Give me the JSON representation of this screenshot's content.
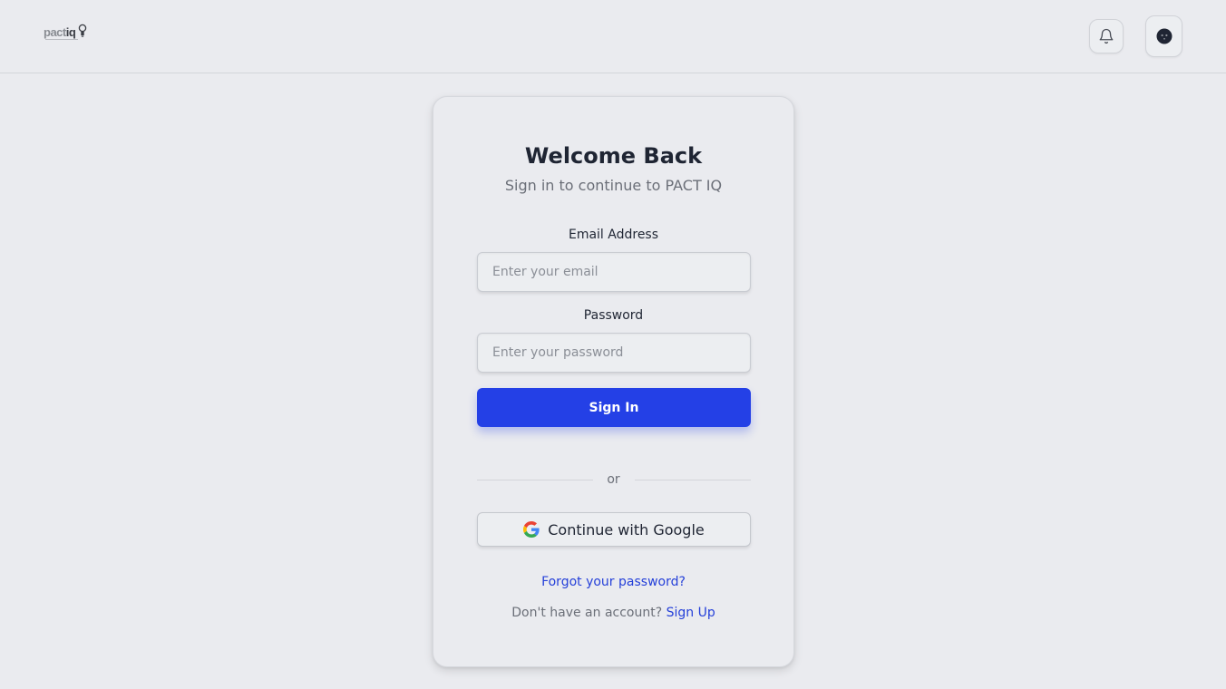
{
  "header": {
    "logo": {
      "word": "pact",
      "suffix": "iq"
    }
  },
  "card": {
    "title": "Welcome Back",
    "subtitle": "Sign in to continue to PACT IQ",
    "email": {
      "label": "Email Address",
      "placeholder": "Enter your email",
      "value": ""
    },
    "password": {
      "label": "Password",
      "placeholder": "Enter your password",
      "value": ""
    },
    "signin_label": "Sign In",
    "divider_text": "or",
    "google_label": "Continue with Google",
    "forgot_label": "Forgot your password?",
    "signup_prompt": "Don't have an account?",
    "signup_label": "Sign Up"
  },
  "icons": {
    "bell": "bell-icon",
    "avatar": "user-avatar-icon",
    "google": "google-logo-icon"
  },
  "colors": {
    "accent": "#2440e6",
    "link": "#2540d9",
    "background": "#eaebef"
  }
}
